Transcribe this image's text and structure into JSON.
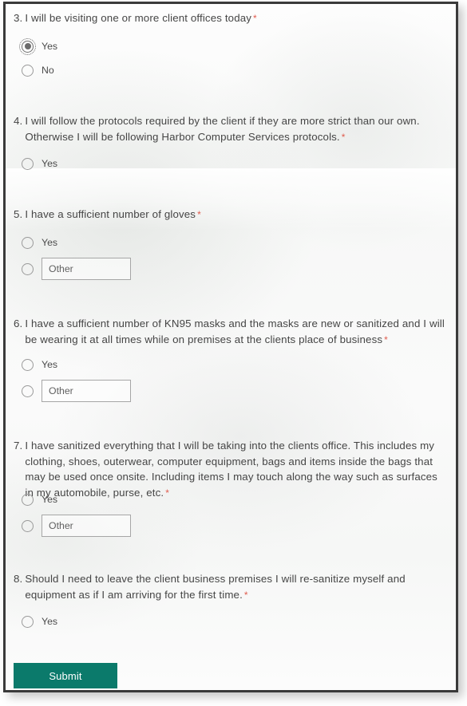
{
  "form": {
    "required_marker": "*",
    "accent_color": "#0b7a6b",
    "required_color": "#e05c4e",
    "text_color": "#454545",
    "questions": [
      {
        "number": "3.",
        "text": "I will be visiting one or more client offices today",
        "required": true,
        "options": [
          {
            "type": "radio",
            "label": "Yes",
            "checked": true,
            "focused": true
          },
          {
            "type": "radio",
            "label": "No",
            "checked": false,
            "focused": false
          }
        ]
      },
      {
        "number": "4.",
        "text": "I will follow the protocols required by the client if they are more strict than our own. Otherwise I will be following Harbor Computer Services protocols.",
        "required": true,
        "options": [
          {
            "type": "radio",
            "label": "Yes",
            "checked": false,
            "focused": false
          }
        ]
      },
      {
        "number": "5.",
        "text": "I have a sufficient number of gloves",
        "required": true,
        "options": [
          {
            "type": "radio",
            "label": "Yes",
            "checked": false,
            "focused": false
          },
          {
            "type": "radio-other",
            "placeholder": "Other",
            "value": "",
            "checked": false,
            "focused": false
          }
        ]
      },
      {
        "number": "6.",
        "text": "I have a sufficient number of KN95 masks and the masks are new or sanitized and I will be wearing it at all times while on premises at the clients place of business",
        "required": true,
        "options": [
          {
            "type": "radio",
            "label": "Yes",
            "checked": false,
            "focused": false
          },
          {
            "type": "radio-other",
            "placeholder": "Other",
            "value": "",
            "checked": false,
            "focused": false
          }
        ]
      },
      {
        "number": "7.",
        "text": "I have sanitized everything that I will be taking into the clients office. This includes my clothing, shoes, outerwear, computer equipment, bags and items inside the bags that may be used once onsite. Including items I may touch along the way such as surfaces in my automobile, purse, etc.",
        "required": true,
        "options": [
          {
            "type": "radio",
            "label": "Yes",
            "checked": false,
            "focused": false
          },
          {
            "type": "radio-other",
            "placeholder": "Other",
            "value": "",
            "checked": false,
            "focused": false
          }
        ]
      },
      {
        "number": "8.",
        "text": "Should I need to leave the client business premises I will re-sanitize myself and equipment as if I am arriving for the first time.",
        "required": true,
        "options": [
          {
            "type": "radio",
            "label": "Yes",
            "checked": false,
            "focused": false
          }
        ]
      }
    ],
    "submit_label": "Submit"
  }
}
